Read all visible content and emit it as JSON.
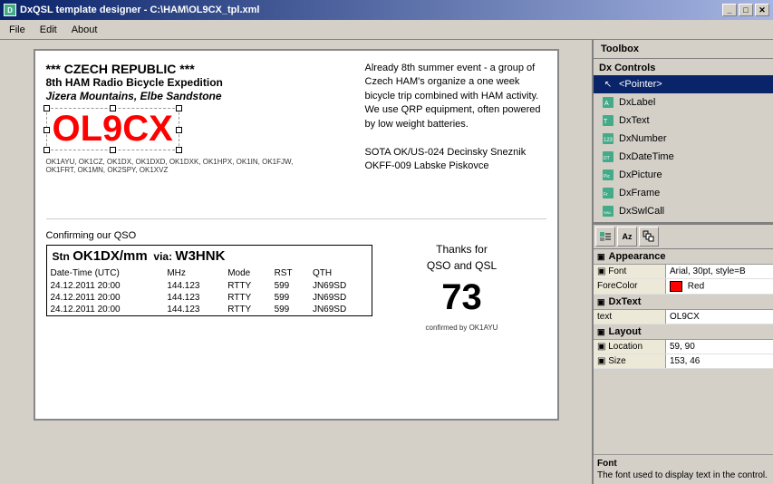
{
  "window": {
    "title": "DxQSL template designer - C:\\HAM\\OL9CX_tpl.xml",
    "icon": "D"
  },
  "titlebar": {
    "minimize": "_",
    "maximize": "□",
    "close": "✕"
  },
  "menu": {
    "items": [
      "File",
      "Edit",
      "About"
    ]
  },
  "toolbox": {
    "title": "Toolbox",
    "section_label": "Dx Controls",
    "pointer_label": "<Pointer>",
    "items": [
      {
        "id": "dxlabel",
        "label": "DxLabel"
      },
      {
        "id": "dxtext",
        "label": "DxText"
      },
      {
        "id": "dxnumber",
        "label": "DxNumber"
      },
      {
        "id": "dxdatetime",
        "label": "DxDateTime"
      },
      {
        "id": "dxpicture",
        "label": "DxPicture"
      },
      {
        "id": "dxframe",
        "label": "DxFrame"
      },
      {
        "id": "dxswlcall",
        "label": "DxSwlCall"
      }
    ]
  },
  "properties": {
    "sections": {
      "appearance": {
        "label": "Appearance",
        "font": {
          "label": "Font",
          "value": "Arial, 30pt, style=B"
        },
        "forecolor": {
          "label": "ForeColor",
          "value": "Red",
          "color": "#FF0000"
        }
      },
      "dxtext": {
        "label": "DxText",
        "text": {
          "label": "text",
          "value": "OL9CX"
        }
      },
      "layout": {
        "label": "Layout",
        "location": {
          "label": "Location",
          "value": "59, 90"
        },
        "size": {
          "label": "Size",
          "value": "153, 46"
        }
      }
    },
    "help": {
      "title": "Font",
      "description": "The font used to display text in the control."
    }
  },
  "qsl_card": {
    "header_line1": "*** CZECH REPUBLIC ***",
    "header_line2": "8th HAM Radio Bicycle Expedition",
    "header_line3": "Jizera Mountains, Elbe Sandstone",
    "callsign": "OL9CX",
    "operators": "OK1AYU, OK1CZ, OK1DX, OK1DXD, OK1DXK, OK1HPX, OK1IN, OK1FJW, OK1FRT, OK1MN, OK2SPY, OK1XVZ",
    "confirming_label": "Confirming our QSO",
    "log_header": {
      "stn_label": "Stn",
      "callsign": "OK1DX/mm",
      "via_label": "via:",
      "via_call": "W3HNK"
    },
    "log_columns": [
      "Date-Time (UTC)",
      "MHz",
      "Mode",
      "RST",
      "QTH"
    ],
    "log_rows": [
      [
        "24.12.2011 20:00",
        "144.123",
        "RTTY",
        "599",
        "JN69SD"
      ],
      [
        "24.12.2011 20:00",
        "144.123",
        "RTTY",
        "599",
        "JN69SD"
      ],
      [
        "24.12.2011 20:00",
        "144.123",
        "RTTY",
        "599",
        "JN69SD"
      ]
    ],
    "right_text": "Already 8th summer event - a group of Czech HAM's organize a one week bicycle trip combined with HAM activity. We use QRP equipment, often powered by low weight batteries.",
    "sota_line1": "SOTA OK/US-024 Decinsky Sneznik",
    "sota_line2": "OKFF-009 Labske Piskovce",
    "thanks_line1": "Thanks for",
    "thanks_line2": "QSO and QSL",
    "number": "73",
    "confirmed_by": "confirmed by OK1AYU"
  }
}
